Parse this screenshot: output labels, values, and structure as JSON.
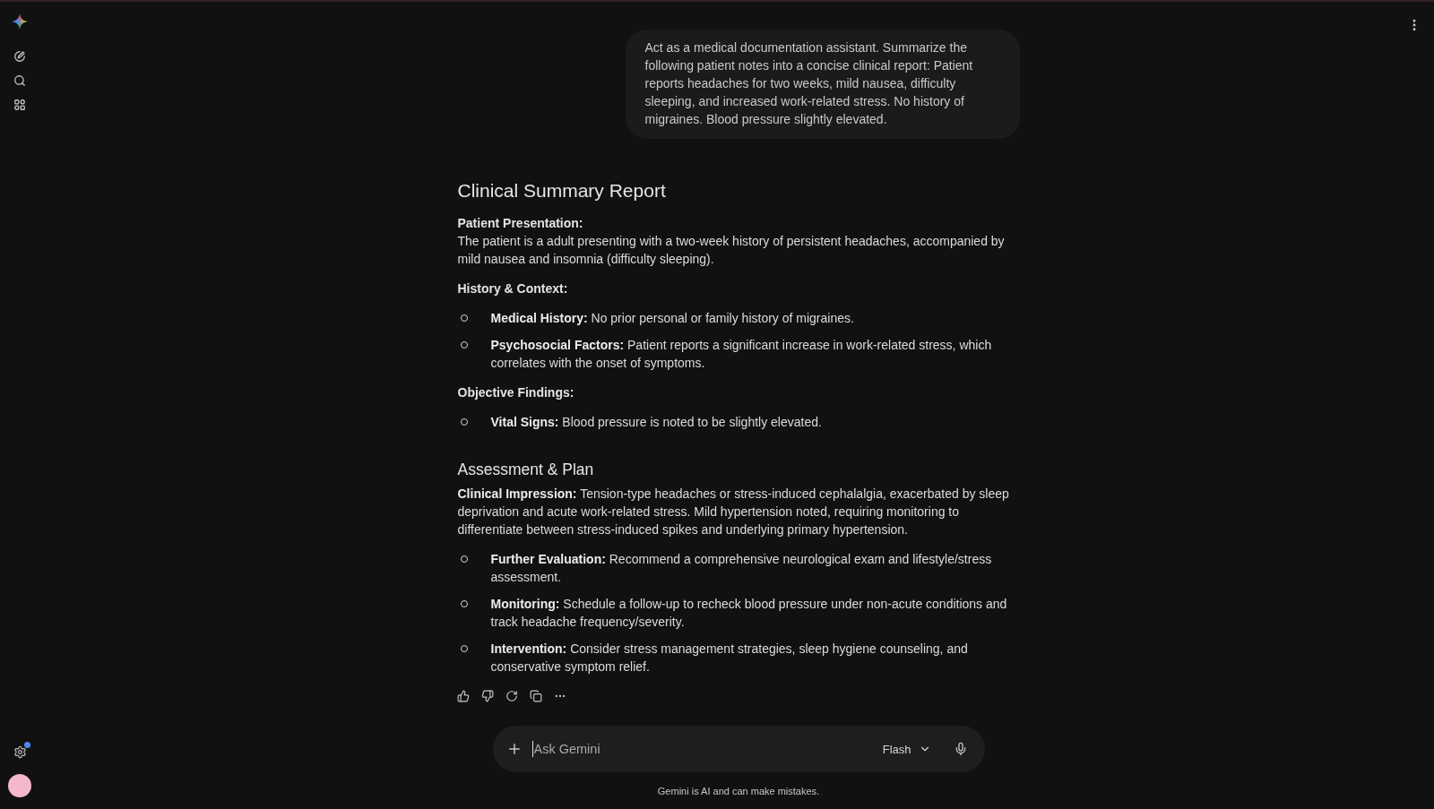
{
  "sidebar": {
    "settings": {
      "notification": true
    }
  },
  "conversation": {
    "user_message": "Act as a medical documentation assistant. Summarize the following patient notes into a concise clinical report: Patient reports headaches for two weeks, mild nausea, difficulty sleeping, and increased work-related stress. No history of migraines. Blood pressure slightly elevated.",
    "response": {
      "sections": [
        {
          "kind": "title",
          "title": "Clinical Summary Report",
          "blocks": [
            {
              "kind": "label",
              "text": "Patient Presentation:"
            },
            {
              "kind": "paragraph",
              "text": "The patient is a adult presenting with a two-week history of persistent headaches, accompanied by mild nausea and insomnia (difficulty sleeping)."
            },
            {
              "kind": "label",
              "text": "History & Context:"
            },
            {
              "kind": "list",
              "items": [
                "**Medical History:** No prior personal or family history of migraines.",
                "**Psychosocial Factors:** Patient reports a significant increase in work-related stress, which correlates with the onset of symptoms."
              ]
            },
            {
              "kind": "label",
              "text": "Objective Findings:"
            },
            {
              "kind": "list",
              "items": [
                "**Vital Signs:** Blood pressure is noted to be slightly elevated."
              ]
            }
          ]
        },
        {
          "kind": "heading",
          "title": "Assessment & Plan",
          "blocks": [
            {
              "kind": "paragraph",
              "text": "**Clinical Impression:** Tension-type headaches or stress-induced cephalalgia, exacerbated by sleep deprivation and acute work-related stress. Mild hypertension noted, requiring monitoring to differentiate between stress-induced spikes and underlying primary hypertension."
            },
            {
              "kind": "list",
              "items": [
                "**Further Evaluation:** Recommend a comprehensive neurological exam and lifestyle/stress assessment.",
                "**Monitoring:** Schedule a follow-up to recheck blood pressure under non-acute conditions and track headache frequency/severity.",
                "**Intervention:** Consider stress management strategies, sleep hygiene counseling, and conservative symptom relief."
              ]
            }
          ]
        }
      ]
    }
  },
  "composer": {
    "input": {
      "placeholder": "Ask Gemini",
      "focused": true
    },
    "model": "Flash"
  },
  "disclaimer": "Gemini is AI and can make mistakes."
}
